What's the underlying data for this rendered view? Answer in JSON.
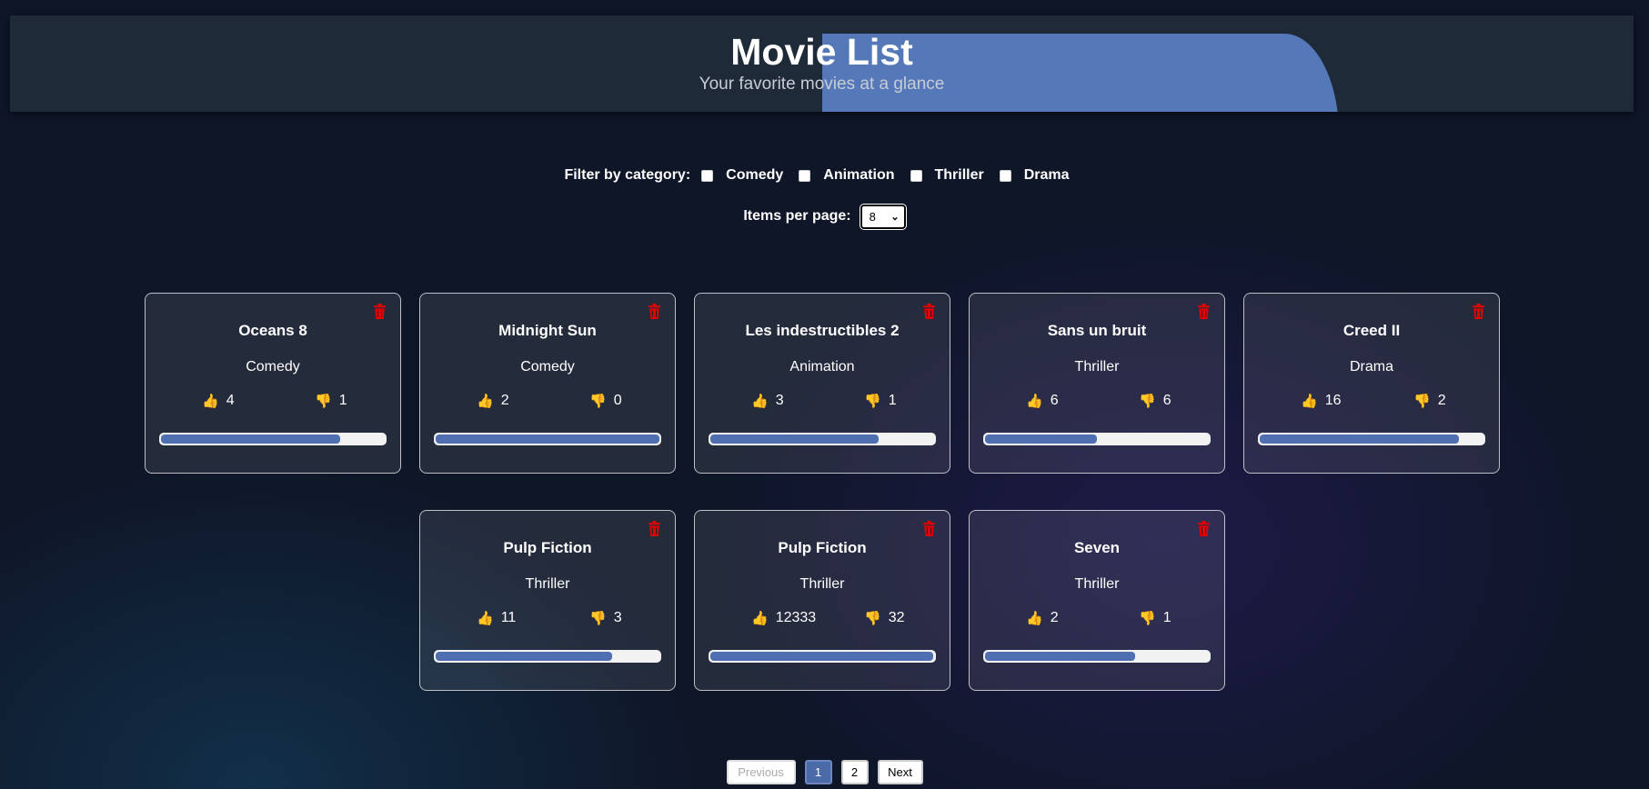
{
  "header": {
    "title": "Movie List",
    "subtitle": "Your favorite movies at a glance"
  },
  "filters": {
    "label": "Filter by category:",
    "options": [
      {
        "label": "Comedy",
        "checked": false
      },
      {
        "label": "Animation",
        "checked": false
      },
      {
        "label": "Thriller",
        "checked": false
      },
      {
        "label": "Drama",
        "checked": false
      }
    ]
  },
  "per_page": {
    "label": "Items per page:",
    "selected": "8"
  },
  "movies": [
    {
      "title": "Oceans 8",
      "category": "Comedy",
      "likes": "4",
      "dislikes": "1",
      "like_ratio": 0.8
    },
    {
      "title": "Midnight Sun",
      "category": "Comedy",
      "likes": "2",
      "dislikes": "0",
      "like_ratio": 1.0
    },
    {
      "title": "Les indestructibles 2",
      "category": "Animation",
      "likes": "3",
      "dislikes": "1",
      "like_ratio": 0.75
    },
    {
      "title": "Sans un bruit",
      "category": "Thriller",
      "likes": "6",
      "dislikes": "6",
      "like_ratio": 0.5
    },
    {
      "title": "Creed II",
      "category": "Drama",
      "likes": "16",
      "dislikes": "2",
      "like_ratio": 0.89
    },
    {
      "title": "Pulp Fiction",
      "category": "Thriller",
      "likes": "11",
      "dislikes": "3",
      "like_ratio": 0.79
    },
    {
      "title": "Pulp Fiction",
      "category": "Thriller",
      "likes": "12333",
      "dislikes": "32",
      "like_ratio": 0.997
    },
    {
      "title": "Seven",
      "category": "Thriller",
      "likes": "2",
      "dislikes": "1",
      "like_ratio": 0.67
    }
  ],
  "icons": {
    "like": "thumbs-up-icon",
    "dislike": "thumbs-down-icon",
    "delete": "trash-icon"
  },
  "colors": {
    "delete": "#e00000",
    "bar_fill": "#4f6fb0",
    "active_page": "#4a6aa8"
  },
  "pagination": {
    "previous": "Previous",
    "pages": [
      "1",
      "2"
    ],
    "current": "1",
    "next": "Next"
  }
}
